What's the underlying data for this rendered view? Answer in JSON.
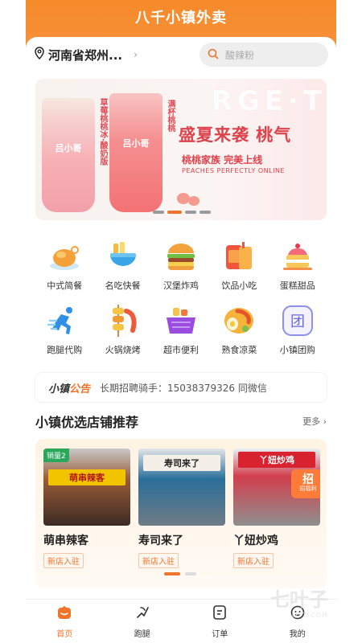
{
  "app": {
    "title": "八千小镇外卖"
  },
  "location": {
    "text": "河南省郑州..."
  },
  "search": {
    "placeholder": "酸辣粉"
  },
  "banner": {
    "cup1_brand": "吕小哥",
    "cup1_tag": "草莓桃桃冰·酸奶版",
    "cup2_brand": "吕小哥",
    "cup2_tag": "满杯桃桃",
    "slogan": "盛夏来袭 桃气",
    "sub_slogan": "桃桃家族 完美上线",
    "en_slogan": "PEACHES PERFECTLY ONLINE",
    "bg_letters": "RGE·T",
    "carousel_count": 4,
    "carousel_active_index": 1
  },
  "categories": [
    {
      "label": "中式简餐",
      "icon": "roast-chicken-icon"
    },
    {
      "label": "名吃快餐",
      "icon": "fast-food-bowl-icon"
    },
    {
      "label": "汉堡炸鸡",
      "icon": "burger-icon"
    },
    {
      "label": "饮品小吃",
      "icon": "drinks-icon"
    },
    {
      "label": "蛋糕甜品",
      "icon": "cake-icon"
    },
    {
      "label": "跑腿代购",
      "icon": "runner-icon"
    },
    {
      "label": "火锅烧烤",
      "icon": "skewer-icon"
    },
    {
      "label": "超市便利",
      "icon": "shopping-basket-icon"
    },
    {
      "label": "熟食凉菜",
      "icon": "deli-plate-icon"
    },
    {
      "label": "小镇团购",
      "icon": "group-buy-icon",
      "glyph": "团"
    }
  ],
  "notice": {
    "brand_part1": "小镇",
    "brand_part2": "公告",
    "text": "长期招聘骑手：15038379326 同微信"
  },
  "section": {
    "title": "小镇优选店铺推荐",
    "more": "更多"
  },
  "shops": [
    {
      "name": "萌串辣客",
      "sign": "萌串辣客",
      "badge": "销量2",
      "tag": "新店入驻"
    },
    {
      "name": "寿司来了",
      "sign": "寿司来了",
      "tag": "新店入驻"
    },
    {
      "name": "丫妞炒鸡",
      "sign": "丫妞炒鸡",
      "promo_big": "招",
      "promo_small": "招福利",
      "tag": "新店入驻"
    }
  ],
  "tabs": [
    {
      "label": "首页",
      "icon": "home-icon",
      "active": true
    },
    {
      "label": "跑腿",
      "icon": "errand-icon",
      "active": false
    },
    {
      "label": "订单",
      "icon": "orders-icon",
      "active": false
    },
    {
      "label": "我的",
      "icon": "profile-icon",
      "active": false
    }
  ],
  "watermark": {
    "main": "七叶子",
    "sub": "QYZ.COM"
  },
  "colors": {
    "brand": "#f58a2a",
    "accent": "#f0742b",
    "alert_red": "#e0414b"
  }
}
